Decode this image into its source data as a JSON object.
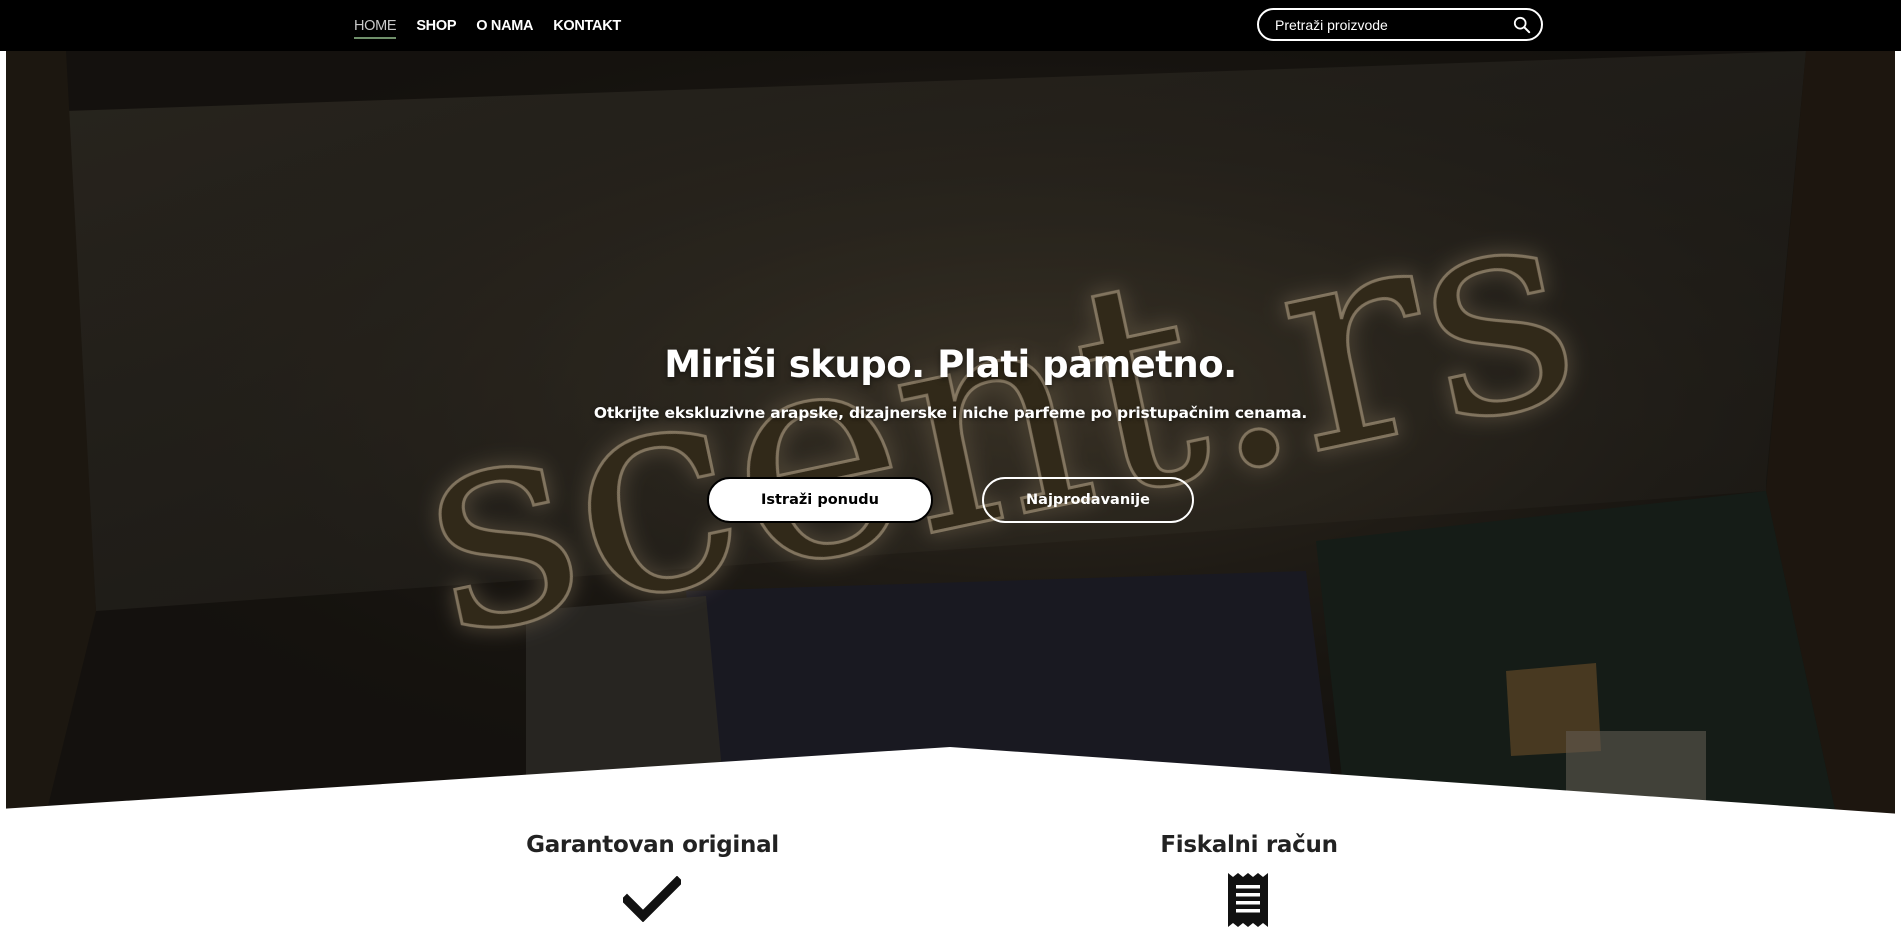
{
  "nav": {
    "items": [
      {
        "label": "HOME",
        "active": true
      },
      {
        "label": "SHOP",
        "active": false
      },
      {
        "label": "O NAMA",
        "active": false
      },
      {
        "label": "KONTAKT",
        "active": false
      }
    ]
  },
  "search": {
    "placeholder": "Pretraži proizvode",
    "icon": "search-icon"
  },
  "hero": {
    "background": "illuminated 'scent.rs' sign photo",
    "sign_text": "scent.rs",
    "title": "Miriši skupo. Plati pametno.",
    "subtitle": "Otkrijte ekskluzivne arapske, dizajnerske i niche parfeme po pristupačnim cenama.",
    "primary_button": "Istraži ponudu",
    "secondary_button": "Najprodavanije"
  },
  "features": [
    {
      "title": "Garantovan original",
      "icon": "checkmark-icon"
    },
    {
      "title": "Fiskalni račun",
      "icon": "receipt-icon"
    }
  ],
  "colors": {
    "topbar": "#000000",
    "accent_underline": "#6f8f6a",
    "text_dark": "#222222"
  }
}
